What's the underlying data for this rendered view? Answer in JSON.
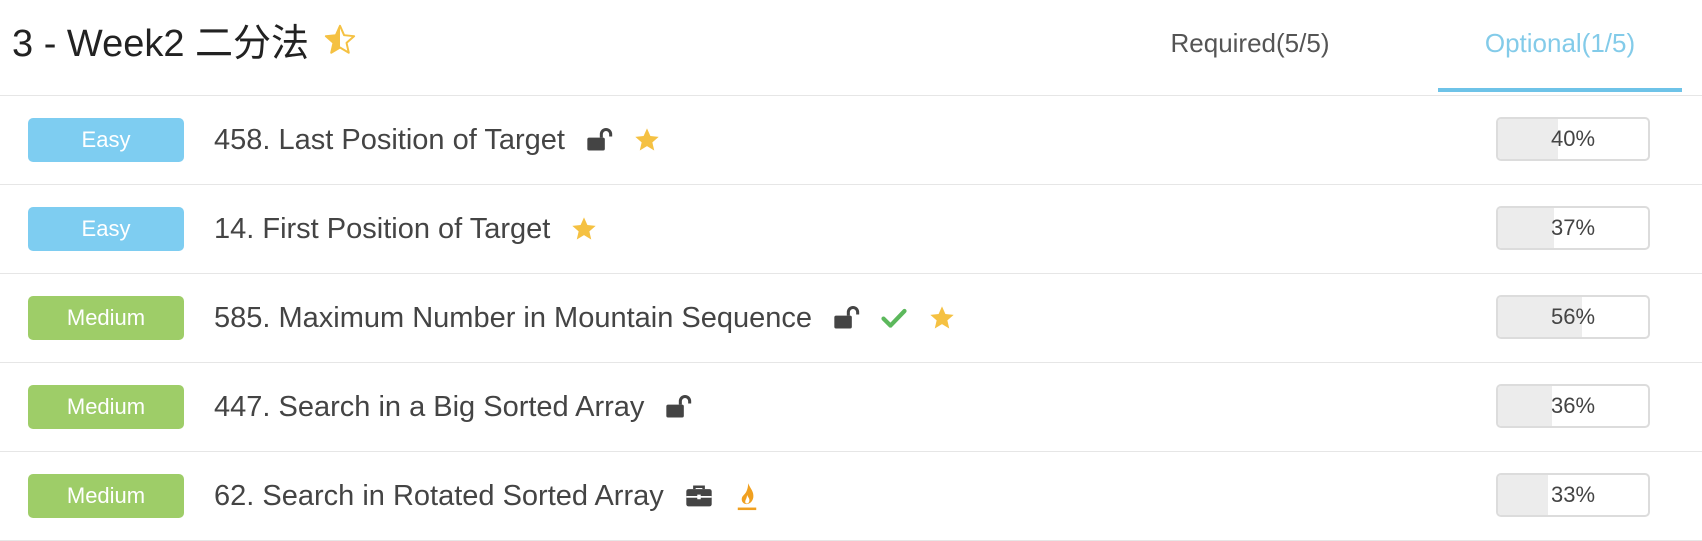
{
  "header": {
    "title": "3 - Week2 二分法"
  },
  "tabs": {
    "required": "Required(5/5)",
    "optional": "Optional(1/5)",
    "active": "optional"
  },
  "problems": [
    {
      "difficulty": "Easy",
      "title": "458. Last Position of Target",
      "icons": [
        "unlock-icon",
        "star-icon"
      ],
      "percent_label": "40%",
      "percent": 40
    },
    {
      "difficulty": "Easy",
      "title": "14. First Position of Target",
      "icons": [
        "star-icon"
      ],
      "percent_label": "37%",
      "percent": 37
    },
    {
      "difficulty": "Medium",
      "title": "585. Maximum Number in Mountain Sequence",
      "icons": [
        "unlock-icon",
        "check-icon",
        "star-icon"
      ],
      "percent_label": "56%",
      "percent": 56
    },
    {
      "difficulty": "Medium",
      "title": "447. Search in a Big Sorted Array",
      "icons": [
        "unlock-icon"
      ],
      "percent_label": "36%",
      "percent": 36
    },
    {
      "difficulty": "Medium",
      "title": "62. Search in Rotated Sorted Array",
      "icons": [
        "briefcase-icon",
        "flame-icon"
      ],
      "percent_label": "33%",
      "percent": 33
    }
  ],
  "colors": {
    "easy": "#7ecdf1",
    "medium": "#9ecd68",
    "active_tab": "#6ec3e8",
    "star": "#f5c142",
    "check": "#5cb85c",
    "flame": "#f0a020"
  }
}
